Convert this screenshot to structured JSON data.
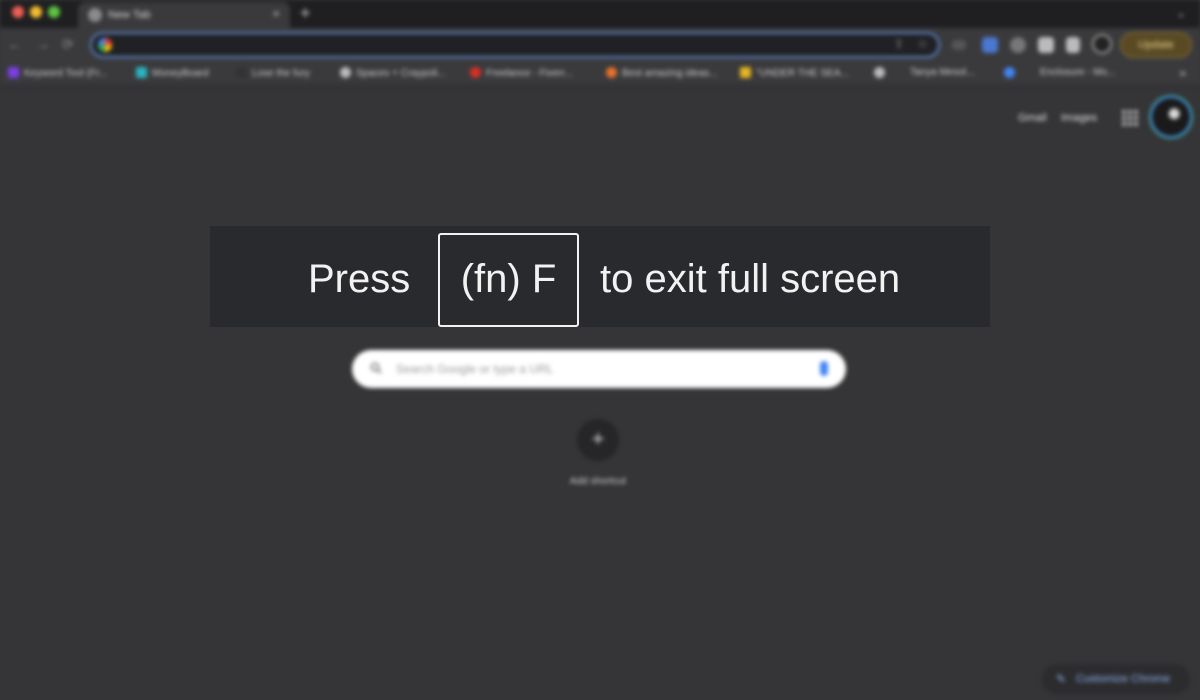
{
  "window": {
    "tab_title": "New Tab",
    "tab_close": "×",
    "new_tab": "+",
    "tab_menu": "⌄"
  },
  "toolbar": {
    "back": "←",
    "forward": "→",
    "reload": "⟳",
    "update_label": "Update"
  },
  "bookmarks": [
    {
      "label": "Keyword Tool (Fr...",
      "color": "#7b3fe4"
    },
    {
      "label": "MoneyBoard",
      "color": "#2bb3c0"
    },
    {
      "label": "Lose the fury",
      "color": "#333333"
    },
    {
      "label": "Spaces + Craypoli...",
      "color": "#bbbbbb"
    },
    {
      "label": "Freelance - Fiverr...",
      "color": "#d93025"
    },
    {
      "label": "Best amazing ideas...",
      "color": "#e8712a"
    },
    {
      "label": "\"UNDER THE SEA...",
      "color": "#e6b422"
    },
    {
      "label": "",
      "color": "#bbbbbb"
    },
    {
      "label": "Tanya Mesol...",
      "color": "#333333"
    },
    {
      "label": "",
      "color": "#4285f4"
    },
    {
      "label": "Enclosure - Mo...",
      "color": "#333333"
    }
  ],
  "bookmarks_more": "»",
  "page": {
    "gmail": "Gmail",
    "images": "Images",
    "search_placeholder": "Search Google or type a URL",
    "add_shortcut_icon": "+",
    "add_shortcut_label": "Add shortcut",
    "customize_icon": "✎",
    "customize_label": "Customize Chrome"
  },
  "fullscreen_banner": {
    "press": "Press",
    "key": "(fn) F",
    "rest": "to exit full screen"
  },
  "colors": {
    "page_background": "#353538",
    "omnibox_focus": "#5e86c9",
    "banner_background": "#292a2d"
  },
  "icons": {
    "omnibox": "google-g-icon",
    "apps": "apps-grid-icon",
    "search": "search-icon",
    "mic": "mic-icon"
  }
}
